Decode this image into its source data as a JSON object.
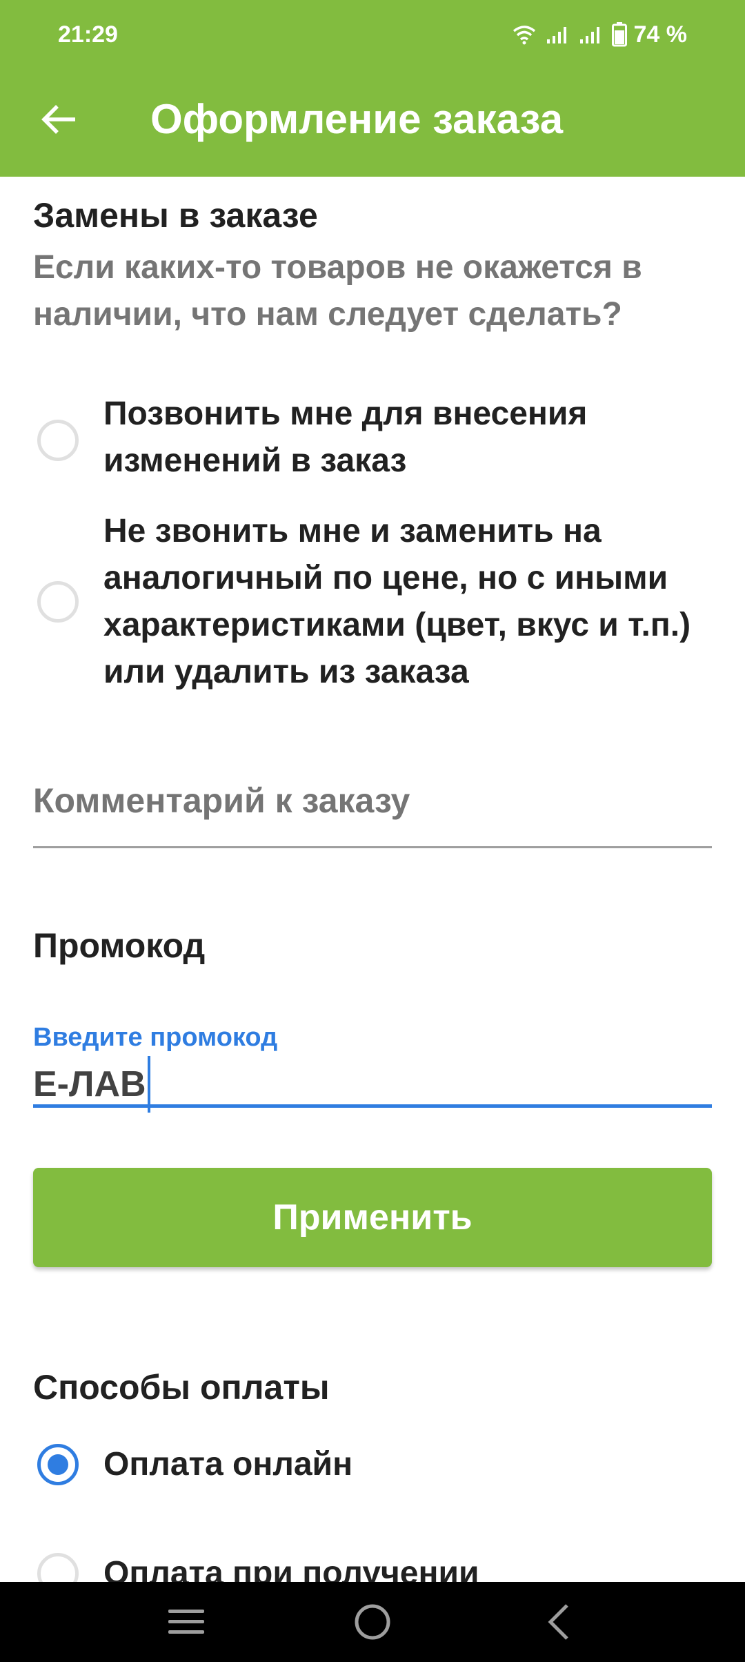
{
  "status_bar": {
    "time": "21:29",
    "battery": "74 %",
    "icons": [
      "wifi-icon",
      "signal-icon",
      "signal-icon",
      "battery-icon"
    ]
  },
  "app_bar": {
    "back_icon": "arrow-left-icon",
    "title": "Оформление заказа",
    "background_color": "#82bc3f"
  },
  "replacements": {
    "title": "Замены в заказе",
    "question": "Если каких-то товаров не окажется в наличии, что нам следует сделать?",
    "options": [
      {
        "label": "Позвонить мне для внесения изменений в заказ",
        "selected": false
      },
      {
        "label": "Не звонить мне и заменить на аналогичный по цене, но с иными характеристиками (цвет, вкус и т.п.) или удалить из заказа",
        "selected": false
      }
    ]
  },
  "comment": {
    "placeholder": "Комментарий к заказу",
    "value": ""
  },
  "promo": {
    "title": "Промокод",
    "field_label": "Введите промокод",
    "value": "Е-ЛАВ",
    "apply_label": "Применить",
    "accent_color": "#2f7de1"
  },
  "payment": {
    "title": "Способы оплаты",
    "options": [
      {
        "label": "Оплата онлайн",
        "selected": true
      },
      {
        "label": "Оплата при получении",
        "selected": false
      }
    ]
  },
  "nav_bar": {
    "icons": [
      "menu-icon",
      "home-icon",
      "back-icon"
    ]
  }
}
